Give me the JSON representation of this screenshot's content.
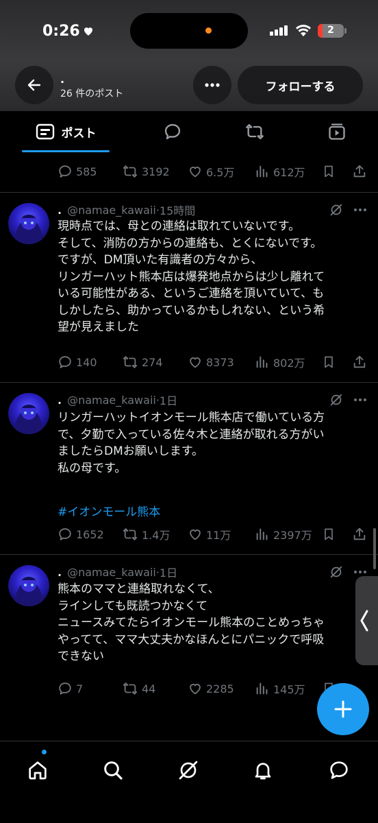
{
  "status_bar": {
    "time": "0:26",
    "battery": "2"
  },
  "header": {
    "profile_name": ".",
    "post_count": "26 件のポスト",
    "follow_label": "フォローする"
  },
  "tabs": [
    {
      "label": "ポスト",
      "icon": "posts-icon"
    },
    {
      "icon": "replies-icon"
    },
    {
      "icon": "reposts-icon"
    },
    {
      "icon": "media-icon"
    }
  ],
  "top_metrics": {
    "replies": "585",
    "reposts": "3192",
    "likes": "6.5万",
    "views": "612万"
  },
  "posts": [
    {
      "name": ".",
      "handle": "@namae_kawaii",
      "time": "15時間",
      "text": "現時点では、母との連絡は取れていないです。\nそして、消防の方からの連絡も、とくにないです。\nですが、DM頂いた有識者の方々から、\nリンガーハット熊本店は爆発地点からは少し離れて\nいる可能性がある、というご連絡を頂いていて、も\nしかしたら、助かっているかもしれない、という希\n望が見えました",
      "replies": "140",
      "reposts": "274",
      "likes": "8373",
      "views": "802万"
    },
    {
      "name": ".",
      "handle": "@namae_kawaii",
      "time": "1日",
      "text": "リンガーハットイオンモール熊本店で働いている方\nで、夕勤で入っている佐々木と連絡が取れる方がい\nましたらDMお願いします。\n私の母です。",
      "hashtag": "#イオンモール熊本",
      "replies": "1652",
      "reposts": "1.4万",
      "likes": "11万",
      "views": "2397万"
    },
    {
      "name": ".",
      "handle": "@namae_kawaii",
      "time": "1日",
      "text": "熊本のママと連絡取れなくて、\nラインしても既読つかなくて\nニュースみてたらイオンモール熊本のことめっちゃ\nやってて、ママ大丈夫かなほんとにパニックで呼吸\nできない",
      "replies": "7",
      "reposts": "44",
      "likes": "2285",
      "views": "145万"
    }
  ],
  "bottom_nav": [
    "home-icon",
    "search-icon",
    "grok-icon",
    "notifications-icon",
    "messages-icon"
  ],
  "colors": {
    "accent": "#1d9bf0",
    "muted": "#71767b",
    "text": "#e7e9ea",
    "divider": "#2f3336"
  }
}
